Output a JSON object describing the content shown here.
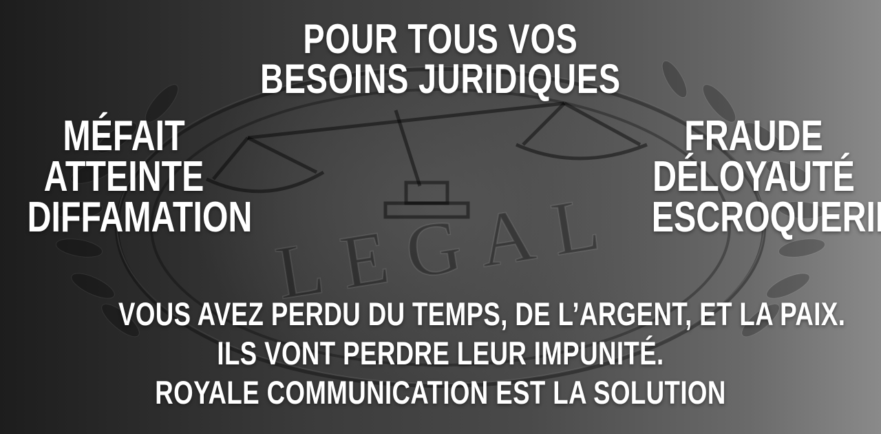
{
  "headline": {
    "line1": "POUR TOUS VOS",
    "line2": "BESOINS JURIDIQUES"
  },
  "left_list": [
    "MÉFAIT",
    "ATTEINTE",
    "DIFFAMATION"
  ],
  "right_list": [
    "FRAUDE",
    "DÉLOYAUTÉ",
    "ESCROQUERIE"
  ],
  "bottom": {
    "line1": "VOUS AVEZ PERDU DU TEMPS, DE L’ARGENT, ET LA PAIX.",
    "line2": "ILS VONT PERDRE LEUR IMPUNITÉ.",
    "line3": "ROYALE COMMUNICATION EST LA SOLUTION"
  },
  "seal": {
    "text": "LEGAL"
  },
  "colors": {
    "text": "#ffffff",
    "background_dark": "#1d1d1d",
    "background_light": "#8a8a8a"
  }
}
